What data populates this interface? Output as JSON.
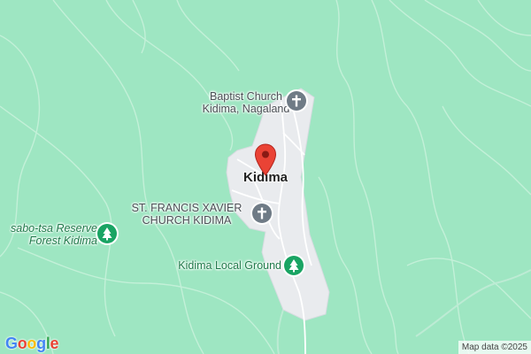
{
  "map": {
    "town_label": "Kidima",
    "places": [
      {
        "name_line1": "Baptist Church",
        "name_line2": "Kidima, Nagaland",
        "icon": "church-cross-icon"
      },
      {
        "name_line1": "ST. FRANCIS XAVIER",
        "name_line2": "CHURCH KIDIMA",
        "icon": "church-cross-icon"
      },
      {
        "name_line1": "sabo-tsa Reserve",
        "name_line2": "Forest Kidima",
        "icon": "tree-icon"
      },
      {
        "name_line1": "Kidima Local Ground",
        "icon": "tree-icon"
      }
    ],
    "pin_icon": "location-pin-icon"
  },
  "footer": {
    "logo_letters": [
      "G",
      "o",
      "o",
      "g",
      "l",
      "e"
    ],
    "logo_colors": [
      "#4285F4",
      "#EA4335",
      "#FBBC05",
      "#4285F4",
      "#34A853",
      "#EA4335"
    ],
    "attribution": "Map data ©2025"
  },
  "colors": {
    "terrain_green": "#9ee6c2",
    "urban_gray": "#e9ebee",
    "contour": "#c3f0d8",
    "church_icon_bg": "#6f7b86",
    "park_icon_bg": "#19a463",
    "pin_red": "#ea4335"
  }
}
